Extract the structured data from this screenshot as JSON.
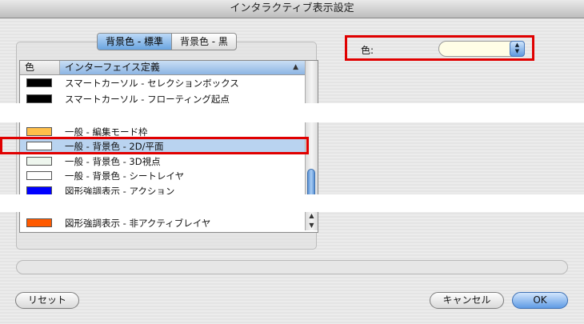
{
  "window": {
    "title": "インタラクティブ表示設定"
  },
  "tabs": [
    {
      "label": "背景色 - 標準",
      "active": true
    },
    {
      "label": "背景色 - 黒",
      "active": false
    }
  ],
  "list": {
    "headers": {
      "color": "色",
      "definition": "インターフェイス定義"
    },
    "rows": [
      {
        "label": "スマートカーソル - セレクションボックス",
        "swatch": "#000000"
      },
      {
        "label": "スマートカーソル - フローティング起点",
        "swatch": "#000000"
      },
      {
        "label": "一般 - 編集モード枠",
        "swatch": "#ffbf4a"
      },
      {
        "label": "一般 - 背景色 - 2D/平面",
        "swatch": "#ffffff",
        "selected": true
      },
      {
        "label": "一般 - 背景色 - 3D視点",
        "swatch": "#eef6ee"
      },
      {
        "label": "一般 - 背景色 - シートレイヤ",
        "swatch": "#ffffff"
      },
      {
        "label": "図形強調表示 - アクション",
        "swatch": "#0000ff"
      },
      {
        "label": "図形強調表示 - 非アクティブレイヤ",
        "swatch": "#ff5a00"
      }
    ]
  },
  "color_setting": {
    "label": "色:",
    "value_color": "#fffde6"
  },
  "buttons": {
    "reset": "リセット",
    "cancel": "キャンセル",
    "ok": "OK"
  },
  "colors": {
    "highlight": "#e00000",
    "accent": "#5f9be4"
  }
}
